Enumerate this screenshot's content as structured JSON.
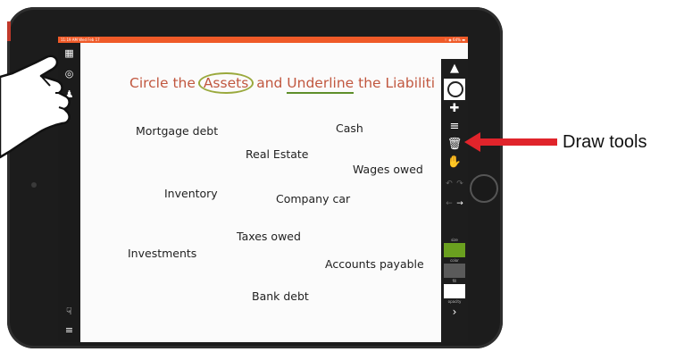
{
  "status_bar": {
    "time": "11:19 AM  Wed Feb 17",
    "right": "⌔ ◉ 64% ▬"
  },
  "worksheet": {
    "title_prefix": "Circle the ",
    "title_assets": "Assets",
    "title_middle": " and ",
    "title_underline": "Underline",
    "title_suffix": " the Liabiliti",
    "items": [
      "Mortgage debt",
      "Cash",
      "Real Estate",
      "Wages owed",
      "Inventory",
      "Company car",
      "Taxes owed",
      "Investments",
      "Accounts payable",
      "Bank debt"
    ]
  },
  "draw_toolbar": {
    "icons": [
      "pen-icon",
      "circle-icon",
      "move-icon",
      "text-lines-icon",
      "trash-icon",
      "hand-icon",
      "undo-icon",
      "redo-icon",
      "arrow-left-icon",
      "arrow-right-icon",
      "chevron-right-icon"
    ],
    "labels": {
      "size": "size",
      "color": "color",
      "fill": "fill",
      "opacity": "opacity"
    },
    "colors": {
      "color_swatch": "#6aa01f",
      "fill_swatch": "#5a5a5a",
      "opacity_swatch": "#ffffff"
    }
  },
  "annotation": {
    "label": "Draw tools",
    "arrow_color": "#e0242b"
  },
  "colors": {
    "status_bar": "#ef5a28",
    "title": "#c1573f",
    "circle": "#9aa93d",
    "underline": "#5e8f2b"
  }
}
